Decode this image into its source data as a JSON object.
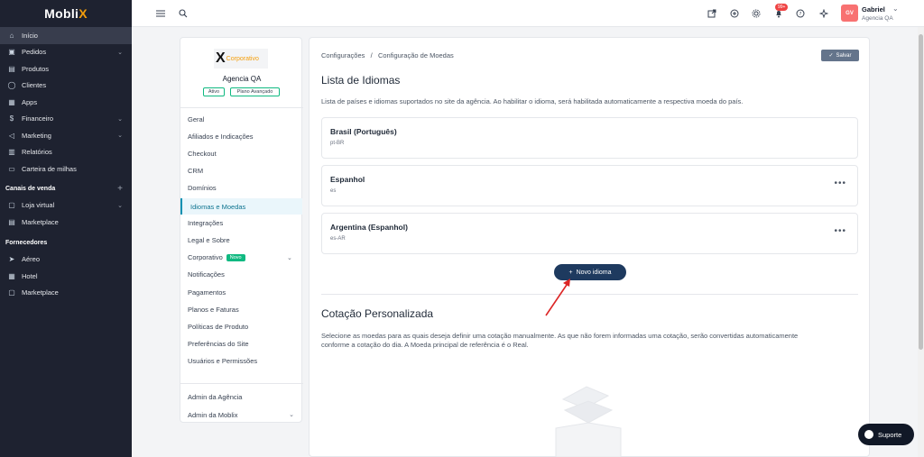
{
  "sidebar": {
    "logo": "Moblix",
    "items": [
      {
        "label": "Início",
        "icon": "home-icon",
        "active": true
      },
      {
        "label": "Pedidos",
        "icon": "cart-icon",
        "chevron": true
      },
      {
        "label": "Produtos",
        "icon": "box-icon"
      },
      {
        "label": "Clientes",
        "icon": "user-icon"
      },
      {
        "label": "Apps",
        "icon": "grid-icon"
      },
      {
        "label": "Financeiro",
        "icon": "dollar-icon",
        "chevron": true
      },
      {
        "label": "Marketing",
        "icon": "megaphone-icon",
        "chevron": true
      },
      {
        "label": "Relatórios",
        "icon": "chart-icon"
      },
      {
        "label": "Carteira de milhas",
        "icon": "wallet-icon"
      }
    ],
    "sales_section": "Canais de venda",
    "sales_items": [
      {
        "label": "Loja virtual",
        "icon": "monitor-icon",
        "chevron": true
      },
      {
        "label": "Marketplace",
        "icon": "store-icon"
      }
    ],
    "supplier_section": "Fornecedores",
    "supplier_items": [
      {
        "label": "Aéreo",
        "icon": "plane-icon"
      },
      {
        "label": "Hotel",
        "icon": "hotel-icon"
      },
      {
        "label": "Marketplace",
        "icon": "map-icon"
      }
    ]
  },
  "topbar": {
    "notif_badge": "99+",
    "avatar_initials": "GV",
    "user_name": "Gabriel",
    "user_agency": "Agencia QA"
  },
  "settings": {
    "logo_text": "Corporativo",
    "agency_name": "Agencia QA",
    "status_badge": "Ativo",
    "plan_badge": "Plano Avançado",
    "items": [
      "Geral",
      "Afiliados e Indicações",
      "Checkout",
      "CRM",
      "Domínios",
      "Idiomas e Moedas",
      "Integrações",
      "Legal e Sobre",
      "Corporativo",
      "Notificações",
      "Pagamentos",
      "Planos e Faturas",
      "Políticas de Produto",
      "Preferências do Site",
      "Usuários e Permissões"
    ],
    "new_tag": "Novo",
    "admin_items": [
      "Admin da Agência",
      "Admin da Moblix"
    ]
  },
  "main": {
    "breadcrumb": "Configurações   /   Configuração de Moedas",
    "save_label": "Salvar",
    "languages_title": "Lista de Idiomas",
    "languages_desc": "Lista de países e idiomas suportados no site da agência. Ao habilitar o idioma, será habilitada automaticamente a respectiva moeda do país.",
    "languages": [
      {
        "name": "Brasil (Português)",
        "code": "pt-BR"
      },
      {
        "name": "Espanhol",
        "code": "es"
      },
      {
        "name": "Argentina (Espanhol)",
        "code": "es-AR"
      }
    ],
    "add_language_label": "Novo idioma",
    "quote_title": "Cotação Personalizada",
    "quote_desc_1": "Selecione as moedas para as quais deseja definir uma cotação manualmente. As que não forem informadas uma cotação, serão convertidas automaticamente",
    "quote_desc_2": "conforme a cotação do dia. A Moeda principal de referência é o Real."
  },
  "support_label": "Suporte",
  "colors": {
    "sidebar": "#1e2230",
    "accent": "#1e3a5f",
    "active": "#0891b2",
    "badge": "#10b981"
  }
}
